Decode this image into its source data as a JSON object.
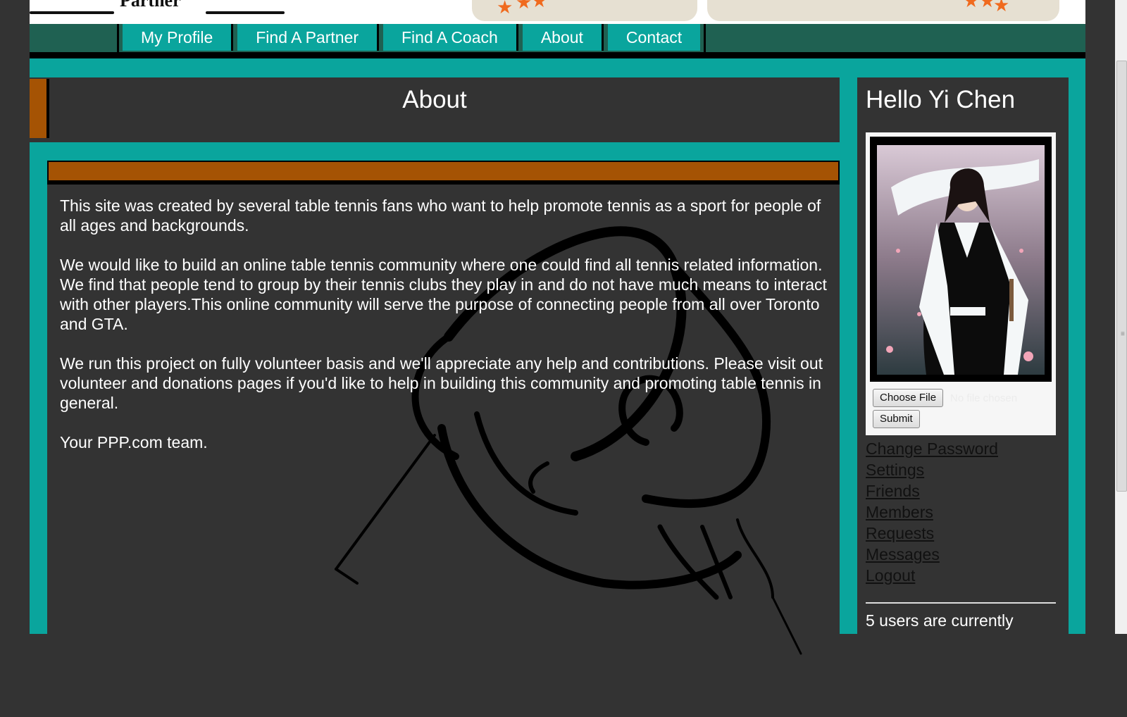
{
  "banner": {
    "logo_text": "Partner"
  },
  "nav": {
    "items": [
      {
        "label": "My Profile"
      },
      {
        "label": "Find A Partner"
      },
      {
        "label": "Find A Coach"
      },
      {
        "label": "About"
      },
      {
        "label": "Contact"
      }
    ]
  },
  "main": {
    "title": "About",
    "paragraphs": [
      "This site was created by several table tennis fans who want to help promote tennis as a sport for people of all ages and backgrounds.",
      "We would like to build an online table tennis community where one could find all tennis related information. We find that people tend to group by their tennis clubs they play in and do not have much means to interact with other players.This online community will serve the purpose of connecting people from all over Toronto and GTA.",
      "We run this project on fully volunteer basis and we'll appreciate any help and contributions. Please visit out volunteer and donations pages if you'd like to help in building this community and promoting table tennis in general.",
      "Your PPP.com team."
    ]
  },
  "sidebar": {
    "greeting": "Hello Yi Chen",
    "choose_file_label": "Choose File",
    "no_file_text": "No file chosen",
    "submit_label": "Submit",
    "links": [
      {
        "label": "Change Password"
      },
      {
        "label": "Settings"
      },
      {
        "label": "Friends"
      },
      {
        "label": "Members"
      },
      {
        "label": "Requests"
      },
      {
        "label": "Messages"
      },
      {
        "label": "Logout"
      }
    ],
    "online_text": "5 users are currently"
  },
  "colors": {
    "teal": "#0aa59d",
    "dark_panel": "#333333",
    "accent_orange": "#a55304",
    "nav_dark": "#1f6152"
  }
}
